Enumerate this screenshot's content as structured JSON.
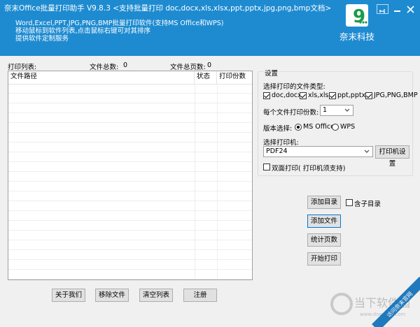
{
  "header": {
    "title": "奈末Office批量打印助手  V9.8.3  <支持批量打印 doc,docx,xls,xlsx,ppt,pptx,jpg,png,bmp文档>",
    "desc_lines": [
      "Word,Excel,PPT,JPG,PNG,BMP批量打印软件(支持MS Office和WPS)",
      "移动鼠标到软件列表,点击鼠标右键可对其排序",
      "提供软件定制服务"
    ],
    "logo_text": "奈末科技",
    "logo_mark": "9"
  },
  "list": {
    "label": "打印列表:",
    "file_total_label": "文件总数:",
    "file_total_value": "0",
    "page_total_label": "文件总页数:",
    "page_total_value": "0",
    "columns": [
      "文件路径",
      "状态",
      "打印份数"
    ]
  },
  "bottom_buttons": {
    "about": "关于我们",
    "remove": "移除文件",
    "clear": "清空列表",
    "register": "注册"
  },
  "settings": {
    "title": "设置",
    "file_types_label": "选择打印的文件类型:",
    "file_types": [
      {
        "label": "doc,docx",
        "checked": true
      },
      {
        "label": "xls,xlsx",
        "checked": true
      },
      {
        "label": "ppt,pptx",
        "checked": true
      },
      {
        "label": "JPG,PNG,BMP",
        "checked": true
      }
    ],
    "copies_label": "每个文件打印份数:",
    "copies_value": "1",
    "version_label": "版本选择:",
    "version_options": [
      {
        "label": "MS Office",
        "selected": true
      },
      {
        "label": "WPS",
        "selected": false
      }
    ],
    "printer_label": "选择打印机:",
    "printer_value": "PDF24",
    "printer_settings_button": "打印机设置",
    "duplex_label": "双面打印( 打印机须支持)",
    "duplex_checked": false
  },
  "actions": {
    "add_folder": "添加目录",
    "include_subfolder": "含子目录",
    "include_subfolder_checked": false,
    "add_file": "添加文件",
    "count_pages": "统计页数",
    "start_print": "开始打印"
  },
  "watermark": {
    "text": "当下软件园",
    "domain": "www.downxia.com",
    "ribbon": "访问奈末官网"
  },
  "colors": {
    "titlebar": "#1e8bd1",
    "logo_green": "#1a9a4a",
    "focus_border": "#0078d7"
  }
}
